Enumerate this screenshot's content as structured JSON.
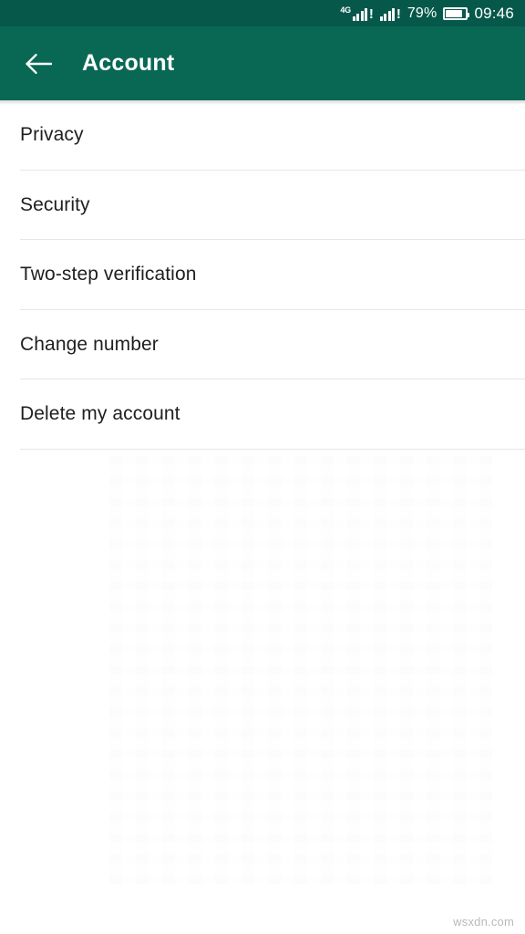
{
  "status_bar": {
    "network_label": "4G",
    "sim1_signal_bars": 4,
    "sim1_alert": "!",
    "sim2_signal_bars": 4,
    "sim2_alert": "!",
    "battery_percent": "79%",
    "battery_level": 79,
    "time": "09:46",
    "background_color": "#06584a",
    "foreground_color": "#ffffff"
  },
  "app_bar": {
    "back_icon": "arrow-left-icon",
    "title": "Account",
    "background_color": "#096854",
    "title_color": "#ffffff"
  },
  "list": {
    "items": [
      {
        "label": "Privacy"
      },
      {
        "label": "Security"
      },
      {
        "label": "Two-step verification"
      },
      {
        "label": "Change number"
      },
      {
        "label": "Delete my account"
      }
    ],
    "text_color": "#1f1f1f",
    "divider_color": "#e6e6e6",
    "background_color": "#ffffff"
  },
  "watermark": {
    "text": "wsxdn.com",
    "color": "#b9b9b9"
  }
}
